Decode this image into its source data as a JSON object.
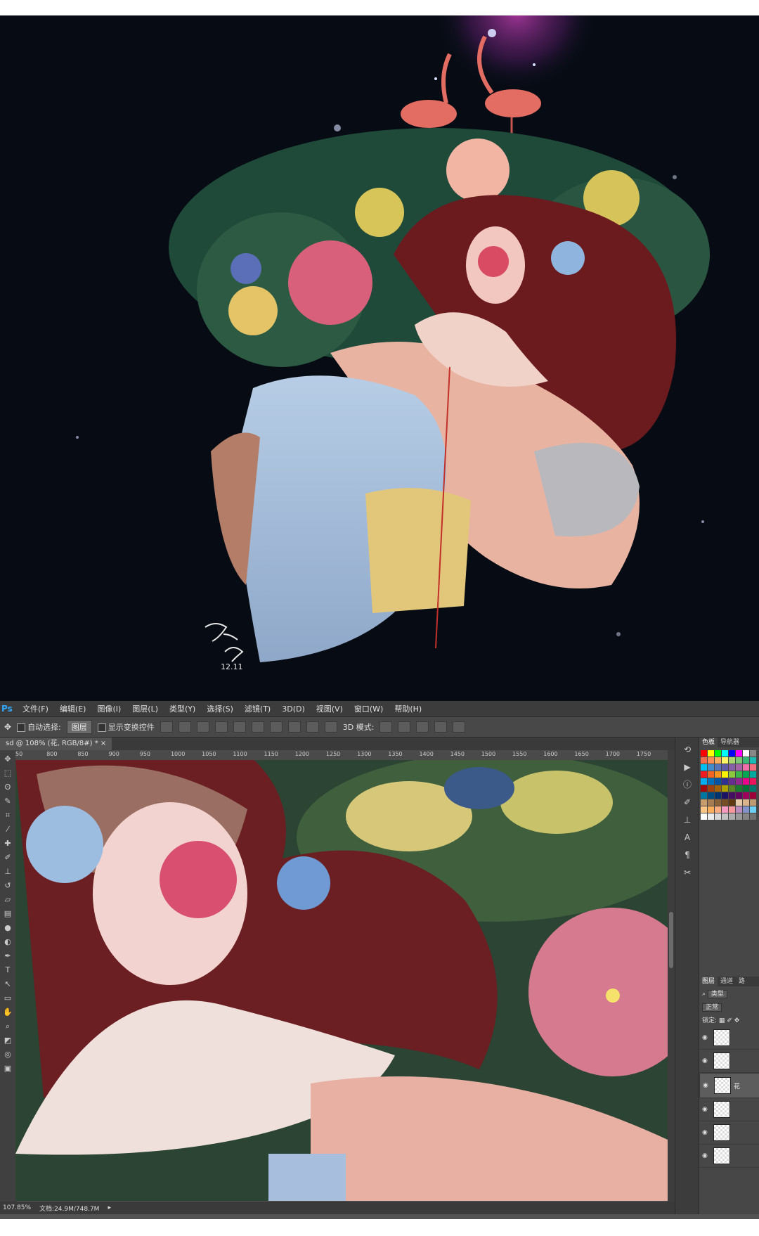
{
  "signature": {
    "date": "12.11"
  },
  "photoshop": {
    "logo": "Ps",
    "menus": [
      "文件(F)",
      "编辑(E)",
      "图像(I)",
      "图层(L)",
      "类型(Y)",
      "选择(S)",
      "滤镜(T)",
      "3D(D)",
      "视图(V)",
      "窗口(W)",
      "帮助(H)"
    ],
    "options": {
      "auto_select_label": "自动选择:",
      "auto_select_value": "图层",
      "show_transform_label": "显示变换控件",
      "mode_3d_label": "3D 模式:"
    },
    "document_tab": "sd @ 108% (花, RGB/8#) *",
    "ruler_ticks": [
      "50",
      "800",
      "850",
      "900",
      "950",
      "1000",
      "1050",
      "1100",
      "1150",
      "1200",
      "1250",
      "1300",
      "1350",
      "1400",
      "1450",
      "1500",
      "1550",
      "1600",
      "1650",
      "1700",
      "1750"
    ],
    "status": {
      "zoom": "107.85%",
      "doc": "文档:24.9M/748.7M"
    },
    "panels": {
      "swatch_tabs": [
        "色板",
        "导航器"
      ],
      "layer_tabs": [
        "图层",
        "通道",
        "路"
      ],
      "filter_label": "类型",
      "blend_mode": "正常",
      "lock_label": "锁定:",
      "selected_layer_label": "花"
    },
    "swatch_colors": [
      "#ff0000",
      "#ffff00",
      "#00ff00",
      "#00ffff",
      "#0000ff",
      "#ff00ff",
      "#ffffff",
      "#888888",
      "#f26c4f",
      "#f68e55",
      "#fbaf5c",
      "#fff467",
      "#acd372",
      "#7cc576",
      "#3bb878",
      "#1abbb4",
      "#00bff3",
      "#438ccb",
      "#5574b9",
      "#605ca8",
      "#855fa8",
      "#a763a8",
      "#f06ea9",
      "#f26d7d",
      "#ed1c24",
      "#f26522",
      "#f7941d",
      "#fff200",
      "#8dc63f",
      "#39b54a",
      "#00a651",
      "#00a99d",
      "#00aeef",
      "#0072bc",
      "#0054a6",
      "#2e3192",
      "#662d91",
      "#92278f",
      "#ec008c",
      "#ed145b",
      "#9e0b0f",
      "#a0410d",
      "#a36209",
      "#aba000",
      "#598527",
      "#1a7b30",
      "#007236",
      "#00746b",
      "#0076a3",
      "#004b80",
      "#003471",
      "#1b1464",
      "#440e62",
      "#630460",
      "#9e005d",
      "#9e0039",
      "#c69c6d",
      "#a67c52",
      "#8c6239",
      "#754c24",
      "#603913",
      "#e6c9a8",
      "#d9b38c",
      "#bf9b73",
      "#fdc689",
      "#fbaf5d",
      "#f9ad81",
      "#f49ac1",
      "#f6989d",
      "#bd8cbf",
      "#8393ca",
      "#6dcff6",
      "#ffffff",
      "#ebebeb",
      "#d7d7d7",
      "#c2c2c2",
      "#adadad",
      "#999999",
      "#858585",
      "#707070"
    ]
  }
}
